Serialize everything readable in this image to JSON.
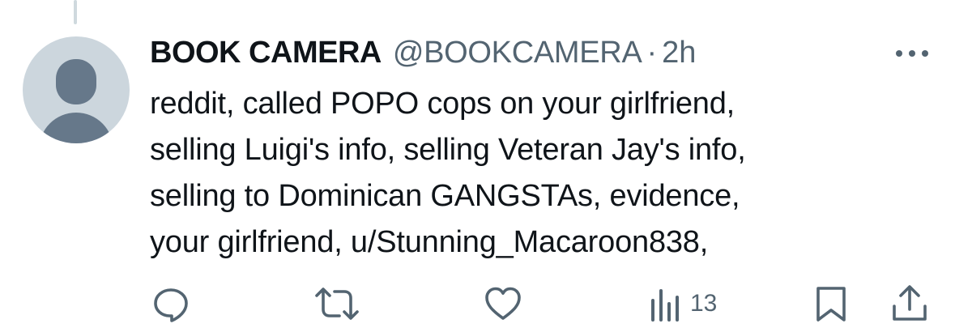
{
  "tweet": {
    "display_name": "BOOK CAMERA",
    "handle": "@BOOKCAMERA",
    "separator": "·",
    "time": "2h",
    "text": "reddit, called POPO cops on your girlfriend,\nselling Luigi's info, selling Veteran Jay's info,\nselling to Dominican GANGSTAs, evidence,\nyour girlfriend, u/Stunning_Macaroon838,"
  },
  "actions": {
    "views_count": "13"
  },
  "icons": {
    "avatar": "default-profile-icon",
    "more": "more-icon",
    "reply": "reply-icon",
    "retweet": "retweet-icon",
    "like": "heart-icon",
    "views": "bar-chart-icon",
    "bookmark": "bookmark-icon",
    "share": "share-icon"
  },
  "colors": {
    "text": "#0f1419",
    "secondary": "#536471",
    "avatar_bg": "#ccd6dd",
    "avatar_fg": "#66788a",
    "thread_line": "#cfd9de"
  }
}
